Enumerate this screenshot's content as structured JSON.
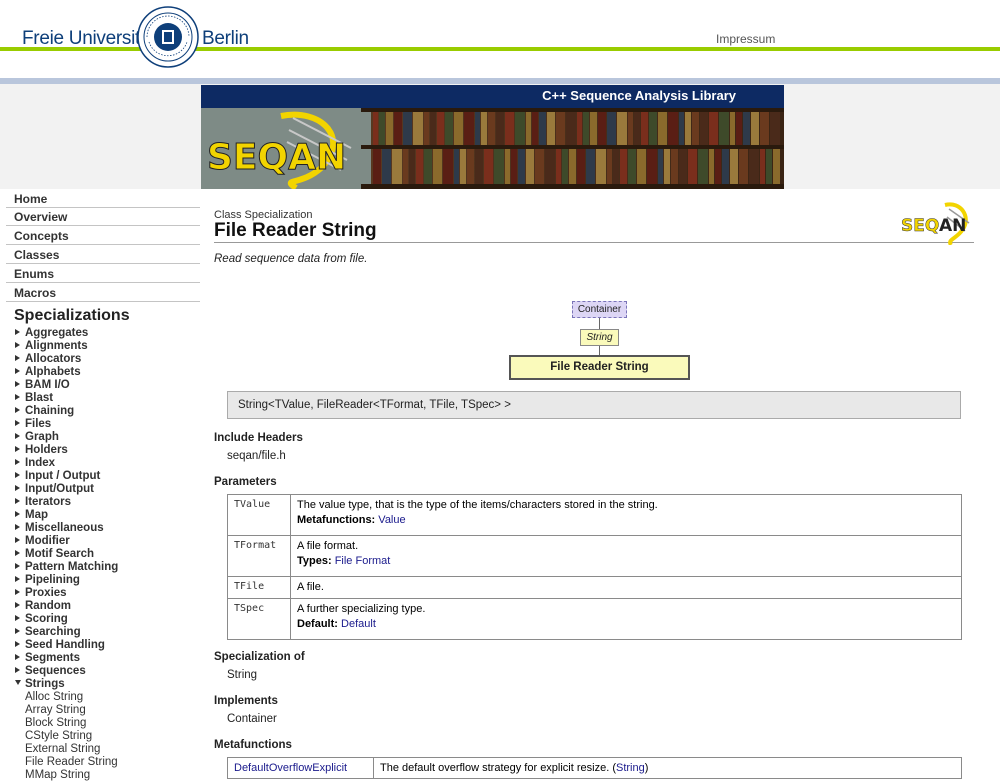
{
  "header": {
    "left_text": "Freie Universität",
    "right_text": "Berlin",
    "impressum": "Impressum",
    "banner_title": "C++ Sequence Analysis Library"
  },
  "sidebar": {
    "nav": [
      "Home",
      "Overview",
      "Concepts",
      "Classes",
      "Enums",
      "Macros"
    ],
    "spec_title": "Specializations",
    "groups": [
      "Aggregates",
      "Alignments",
      "Allocators",
      "Alphabets",
      "BAM I/O",
      "Blast",
      "Chaining",
      "Files",
      "Graph",
      "Holders",
      "Index",
      "Input / Output",
      "Input/Output",
      "Iterators",
      "Map",
      "Miscellaneous",
      "Modifier",
      "Motif Search",
      "Pattern Matching",
      "Pipelining",
      "Proxies",
      "Random",
      "Scoring",
      "Searching",
      "Seed Handling",
      "Segments",
      "Sequences"
    ],
    "expanded_group": "Strings",
    "sub_items": [
      "Alloc String",
      "Array String",
      "Block String",
      "CStyle String",
      "External String",
      "File Reader String",
      "MMap String"
    ]
  },
  "main": {
    "kind": "Class Specialization",
    "title": "File Reader String",
    "summary": "Read sequence data from file.",
    "diagram": {
      "container": "Container",
      "string": "String",
      "current": "File Reader String"
    },
    "signature": "String<TValue, FileReader<TFormat, TFile, TSpec> >",
    "include_headers_label": "Include Headers",
    "include_header": "seqan/file.h",
    "parameters_label": "Parameters",
    "parameters": [
      {
        "name": "TValue",
        "desc": "The value type, that is the type of the items/characters stored in the string.",
        "extra_label": "Metafunctions:",
        "extra_link": "Value"
      },
      {
        "name": "TFormat",
        "desc": "A file format.",
        "extra_label": "Types:",
        "extra_link": "File Format"
      },
      {
        "name": "TFile",
        "desc": "A file."
      },
      {
        "name": "TSpec",
        "desc": "A further specializing type.",
        "extra_label": "Default:",
        "extra_link": "Default"
      }
    ],
    "specialization_of_label": "Specialization of",
    "specialization_of": "String",
    "implements_label": "Implements",
    "implements": "Container",
    "metafunctions_label": "Metafunctions",
    "metafunctions": [
      {
        "name": "DefaultOverflowExplicit",
        "desc_prefix": "The default overflow strategy for explicit resize. (",
        "link": "String",
        "desc_suffix": ")"
      }
    ]
  }
}
